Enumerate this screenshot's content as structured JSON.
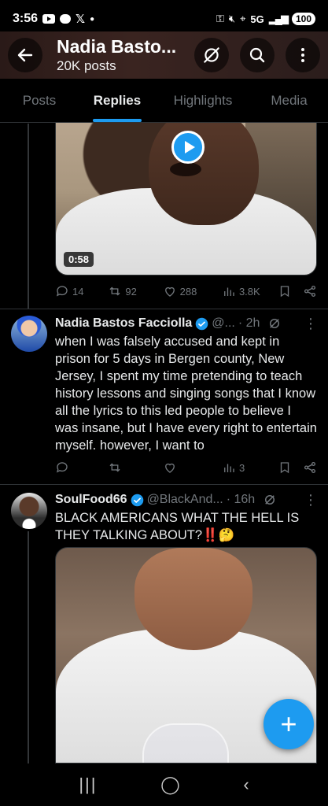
{
  "status_bar": {
    "time": "3:56",
    "network": "5G",
    "battery": "100"
  },
  "header": {
    "title": "Nadia Basto...",
    "posts": "20K posts"
  },
  "tabs": [
    {
      "label": "Posts",
      "active": false
    },
    {
      "label": "Replies",
      "active": true
    },
    {
      "label": "Highlights",
      "active": false
    },
    {
      "label": "Media",
      "active": false
    }
  ],
  "post1": {
    "video_duration": "0:58",
    "stats": {
      "replies": "14",
      "reposts": "92",
      "likes": "288",
      "views": "3.8K"
    }
  },
  "post2": {
    "name": "Nadia Bastos Facciolla",
    "handle": "@...",
    "time": "· 2h",
    "text": "when I was falsely accused and kept in prison for 5 days in Bergen county, New Jersey, I spent my time pretending to teach history lessons and singing songs that I know all the lyrics to this led people to believe I was insane, but I have every right to entertain myself. however, I want to",
    "stats": {
      "replies": "",
      "reposts": "",
      "likes": "",
      "views": "3"
    }
  },
  "post3": {
    "name": "SoulFood66",
    "handle": "@BlackAnd...",
    "time": "· 16h",
    "text": "BLACK AMERICANS WHAT THE HELL IS THEY TALKING ABOUT?‼️🤔"
  },
  "colors": {
    "accent": "#1d9bf0",
    "muted": "#71767b",
    "background": "#000000",
    "divider": "#2f3336"
  },
  "icons": {
    "back": "arrow-left-icon",
    "notifications_off": "bell-slash-icon",
    "search": "search-icon",
    "more": "more-vertical-icon",
    "fab": "plus-icon"
  }
}
